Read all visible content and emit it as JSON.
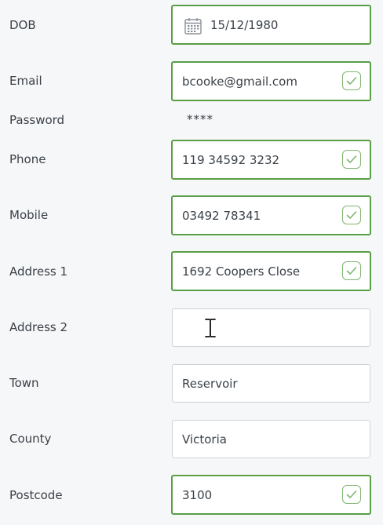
{
  "form": {
    "dob": {
      "label": "DOB",
      "value": "15/12/1980",
      "icon": "calendar-icon"
    },
    "email": {
      "label": "Email",
      "value": "bcooke@gmail.com",
      "valid": true
    },
    "password": {
      "label": "Password",
      "value": "****"
    },
    "phone": {
      "label": "Phone",
      "value": "119 34592 3232",
      "valid": true
    },
    "mobile": {
      "label": "Mobile",
      "value": "03492 78341",
      "valid": true
    },
    "address1": {
      "label": "Address 1",
      "value": "1692 Coopers Close",
      "valid": true
    },
    "address2": {
      "label": "Address 2",
      "value": ""
    },
    "town": {
      "label": "Town",
      "value": "Reservoir"
    },
    "county": {
      "label": "County",
      "value": "Victoria"
    },
    "postcode": {
      "label": "Postcode",
      "value": "3100",
      "valid": true
    }
  },
  "colors": {
    "valid_border": "#5a9e45",
    "plain_border": "#cfd3d7",
    "background": "#f6f7f8"
  }
}
